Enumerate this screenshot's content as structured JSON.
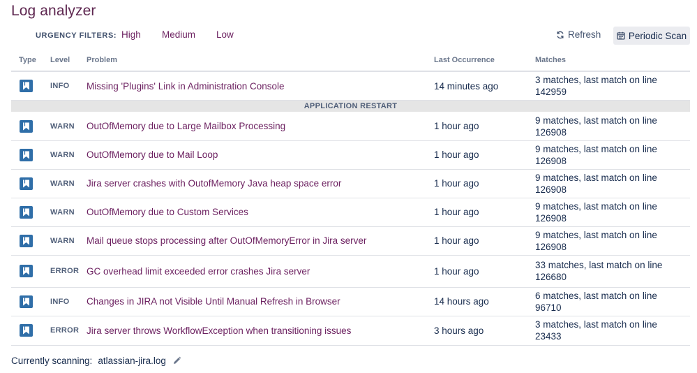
{
  "page": {
    "title": "Log analyzer"
  },
  "filters": {
    "label": "URGENCY FILTERS:",
    "options": [
      "High",
      "Medium",
      "Low"
    ]
  },
  "toolbar": {
    "refresh_label": "Refresh",
    "refresh_icon": "refresh-icon",
    "scan_label": "Periodic Scan",
    "scan_icon": "calendar-icon"
  },
  "table": {
    "columns": [
      "Type",
      "Level",
      "Problem",
      "Last Occurrence",
      "Matches"
    ],
    "group_label": "APPLICATION RESTART",
    "type_icon": "knowledge-base-icon",
    "type_icon_color": "#2f6ea8",
    "rows": [
      {
        "level": "INFO",
        "problem": "Missing 'Plugins' Link in Administration Console",
        "last": "14 minutes ago",
        "matches": "3 matches, last match on line 142959"
      },
      {
        "level": "WARN",
        "problem": "OutOfMemory due to Large Mailbox Processing",
        "last": "1 hour ago",
        "matches": "9 matches, last match on line 126908"
      },
      {
        "level": "WARN",
        "problem": "OutOfMemory due to Mail Loop",
        "last": "1 hour ago",
        "matches": "9 matches, last match on line 126908"
      },
      {
        "level": "WARN",
        "problem": "Jira server crashes with OutofMemory Java heap space error",
        "last": "1 hour ago",
        "matches": "9 matches, last match on line 126908"
      },
      {
        "level": "WARN",
        "problem": "OutOfMemory due to Custom Services",
        "last": "1 hour ago",
        "matches": "9 matches, last match on line 126908"
      },
      {
        "level": "WARN",
        "problem": "Mail queue stops processing after OutOfMemoryError in Jira server",
        "last": "1 hour ago",
        "matches": "9 matches, last match on line 126908"
      },
      {
        "level": "ERROR",
        "problem": "GC overhead limit exceeded error crashes Jira server",
        "last": "1 hour ago",
        "matches": "33 matches, last match on line 126680"
      },
      {
        "level": "INFO",
        "problem": "Changes in JIRA not Visible Until Manual Refresh in Browser",
        "last": "14 hours ago",
        "matches": "6 matches, last match on line 96710"
      },
      {
        "level": "ERROR",
        "problem": "Jira server throws WorkflowException when transitioning issues",
        "last": "3 hours ago",
        "matches": "3 matches, last match on line 23433"
      }
    ]
  },
  "footer": {
    "label": "Currently scanning:",
    "file": "atlassian-jira.log",
    "edit_icon": "pencil-icon"
  },
  "colors": {
    "accent": "#6b1f5f",
    "title": "#5e2750"
  }
}
